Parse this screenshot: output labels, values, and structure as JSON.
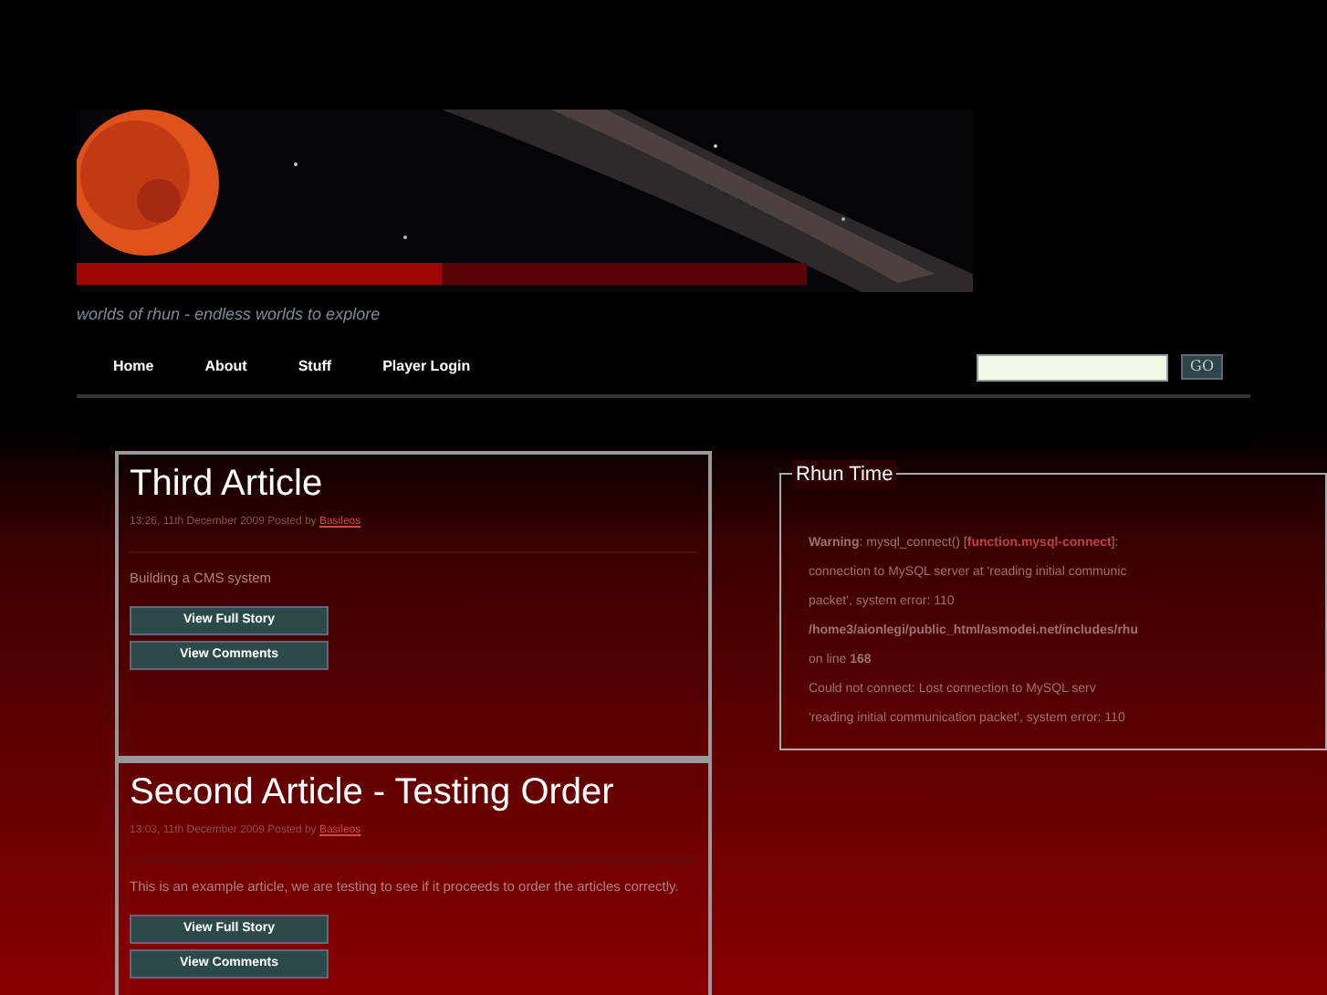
{
  "header": {
    "tagline": "worlds of rhun - endless worlds to explore"
  },
  "nav": {
    "items": [
      {
        "label": "Home"
      },
      {
        "label": "About"
      },
      {
        "label": "Stuff"
      },
      {
        "label": "Player Login"
      }
    ],
    "search_button": "GO"
  },
  "articles": [
    {
      "title": "Third Article",
      "meta": "13:26, 11th December 2009 Posted by",
      "author": "Basileos",
      "body": "Building a CMS system",
      "buttons": [
        "View Full Story",
        "View Comments"
      ]
    },
    {
      "title": "Second Article - Testing Order",
      "meta": "13:03, 11th December 2009 Posted by",
      "author": "Basileos",
      "body": "This is an example article, we are testing to see if it proceeds to order the articles correctly.",
      "buttons": [
        "View Full Story",
        "View Comments"
      ]
    }
  ],
  "sidebar": {
    "title": "Rhun Time",
    "lines": [
      [
        {
          "kind": "bold",
          "text": "Warning"
        },
        {
          "kind": "plain",
          "text": ": mysql_connect() ["
        },
        {
          "kind": "link",
          "text": "function.mysql-connect"
        },
        {
          "kind": "plain",
          "text": "]:"
        }
      ],
      [
        {
          "kind": "plain",
          "text": "connection to MySQL server at 'reading initial communic"
        }
      ],
      [
        {
          "kind": "plain",
          "text": "packet', system error: 110"
        }
      ],
      [
        {
          "kind": "bold",
          "text": "/home3/aionlegi/public_html/asmodei.net/includes/rhu"
        }
      ],
      [
        {
          "kind": "plain",
          "text": "on line "
        },
        {
          "kind": "bold",
          "text": "168"
        }
      ],
      [
        {
          "kind": "plain",
          "text": "Could not connect: Lost connection to MySQL serv"
        }
      ],
      [
        {
          "kind": "plain",
          "text": "'reading initial communication packet', system error: 110"
        }
      ]
    ]
  }
}
